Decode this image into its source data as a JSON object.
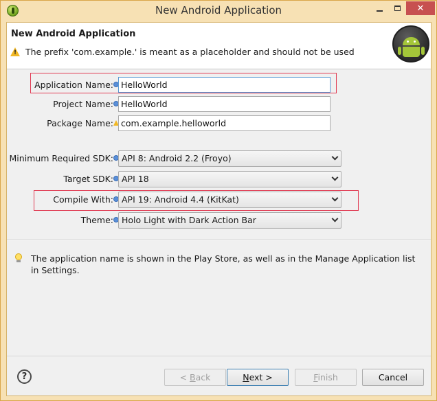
{
  "window": {
    "title": "New Android Application",
    "close_label": "✕"
  },
  "header": {
    "title": "New Android Application",
    "message": "The prefix 'com.example.' is meant as a placeholder and should not be used"
  },
  "form": {
    "app_name": {
      "label": "Application Name:",
      "value": "HelloWorld"
    },
    "project_name": {
      "label": "Project Name:",
      "value": "HelloWorld"
    },
    "package_name": {
      "label": "Package Name:",
      "value": "com.example.helloworld"
    },
    "min_sdk": {
      "label": "Minimum Required SDK:",
      "value": "API 8: Android 2.2 (Froyo)"
    },
    "target_sdk": {
      "label": "Target SDK:",
      "value": "API 18"
    },
    "compile_with": {
      "label": "Compile With:",
      "value": "API 19: Android 4.4 (KitKat)"
    },
    "theme": {
      "label": "Theme:",
      "value": "Holo Light with Dark Action Bar"
    }
  },
  "hint": {
    "text": "The application name is shown in the Play Store, as well as in the Manage Application list in Settings."
  },
  "buttons": {
    "help": "?",
    "back_prefix": "< ",
    "back_underlined": "B",
    "back_rest": "ack",
    "next_underlined": "N",
    "next_rest": "ext >",
    "finish_underlined": "F",
    "finish_rest": "inish",
    "cancel": "Cancel"
  },
  "colors": {
    "highlight": "#e03a52",
    "frame": "#f7e1b4",
    "close_button": "#c75050"
  }
}
